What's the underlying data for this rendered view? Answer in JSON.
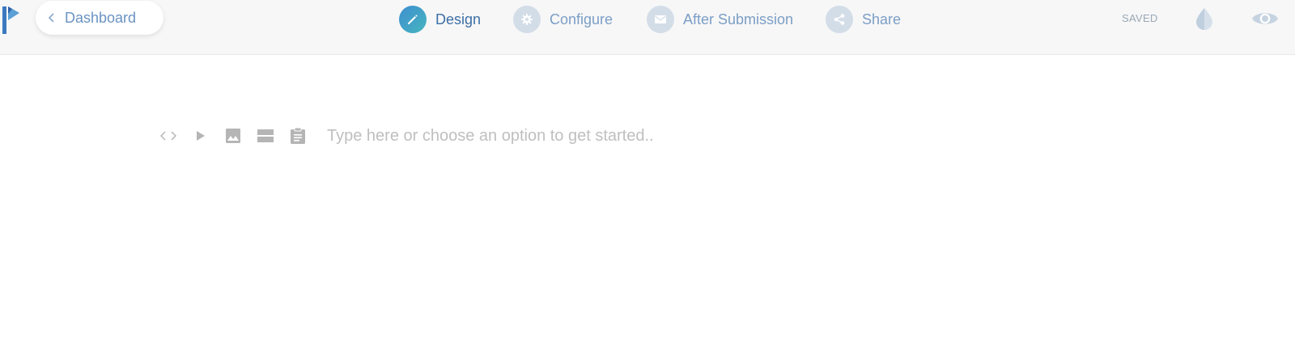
{
  "header": {
    "back_label": "Dashboard",
    "steps": [
      {
        "label": "Design",
        "icon": "pencil-icon",
        "active": true
      },
      {
        "label": "Configure",
        "icon": "gear-icon",
        "active": false
      },
      {
        "label": "After Submission",
        "icon": "envelope-icon",
        "active": false
      },
      {
        "label": "Share",
        "icon": "share-icon",
        "active": false
      }
    ],
    "status": "SAVED",
    "actions": [
      {
        "icon": "droplet-icon"
      },
      {
        "icon": "eye-icon"
      }
    ]
  },
  "editor": {
    "tools": [
      {
        "icon": "code-icon"
      },
      {
        "icon": "play-icon"
      },
      {
        "icon": "image-icon"
      },
      {
        "icon": "divider-icon"
      },
      {
        "icon": "clipboard-icon"
      }
    ],
    "input_value": "",
    "placeholder": "Type here or choose an option to get started.."
  },
  "colors": {
    "accent": "#3d6fa6",
    "step_inactive": "#d3dde8",
    "muted_text": "#7b9ec6",
    "topbar_bg": "#f7f7f7",
    "icon_gray": "#c2c2c2",
    "placeholder": "#bfbfbf"
  }
}
